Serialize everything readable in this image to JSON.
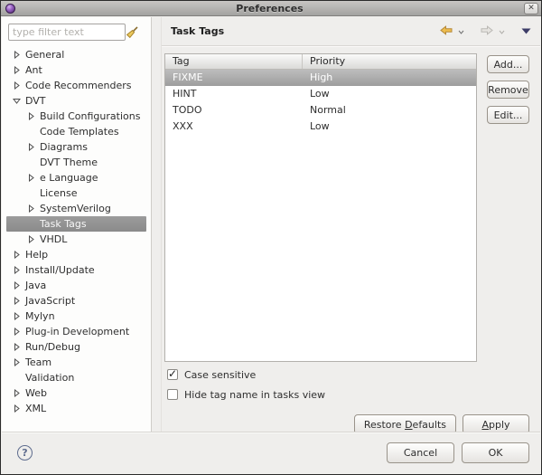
{
  "window": {
    "title": "Preferences",
    "close_glyph": "✕"
  },
  "sidebar": {
    "filter": {
      "placeholder": "type filter text",
      "clear_icon": "broom"
    },
    "items": [
      {
        "label": "General",
        "level": 0,
        "state": "collapsed",
        "selected": false
      },
      {
        "label": "Ant",
        "level": 0,
        "state": "collapsed",
        "selected": false
      },
      {
        "label": "Code Recommenders",
        "level": 0,
        "state": "collapsed",
        "selected": false
      },
      {
        "label": "DVT",
        "level": 0,
        "state": "expanded",
        "selected": false
      },
      {
        "label": "Build Configurations",
        "level": 1,
        "state": "collapsed",
        "selected": false
      },
      {
        "label": "Code Templates",
        "level": 1,
        "state": "leaf",
        "selected": false
      },
      {
        "label": "Diagrams",
        "level": 1,
        "state": "collapsed",
        "selected": false
      },
      {
        "label": "DVT Theme",
        "level": 1,
        "state": "leaf",
        "selected": false
      },
      {
        "label": "e Language",
        "level": 1,
        "state": "collapsed",
        "selected": false
      },
      {
        "label": "License",
        "level": 1,
        "state": "leaf",
        "selected": false
      },
      {
        "label": "SystemVerilog",
        "level": 1,
        "state": "collapsed",
        "selected": false
      },
      {
        "label": "Task Tags",
        "level": 1,
        "state": "leaf",
        "selected": true
      },
      {
        "label": "VHDL",
        "level": 1,
        "state": "collapsed",
        "selected": false
      },
      {
        "label": "Help",
        "level": 0,
        "state": "collapsed",
        "selected": false
      },
      {
        "label": "Install/Update",
        "level": 0,
        "state": "collapsed",
        "selected": false
      },
      {
        "label": "Java",
        "level": 0,
        "state": "collapsed",
        "selected": false
      },
      {
        "label": "JavaScript",
        "level": 0,
        "state": "collapsed",
        "selected": false
      },
      {
        "label": "Mylyn",
        "level": 0,
        "state": "collapsed",
        "selected": false
      },
      {
        "label": "Plug-in Development",
        "level": 0,
        "state": "collapsed",
        "selected": false
      },
      {
        "label": "Run/Debug",
        "level": 0,
        "state": "collapsed",
        "selected": false
      },
      {
        "label": "Team",
        "level": 0,
        "state": "collapsed",
        "selected": false
      },
      {
        "label": "Validation",
        "level": 0,
        "state": "leaf",
        "selected": false
      },
      {
        "label": "Web",
        "level": 0,
        "state": "collapsed",
        "selected": false
      },
      {
        "label": "XML",
        "level": 0,
        "state": "collapsed",
        "selected": false
      }
    ]
  },
  "content": {
    "title": "Task Tags",
    "nav_icons": [
      "back-arrow",
      "back-dropdown",
      "forward-arrow",
      "forward-dropdown",
      "view-menu"
    ],
    "table": {
      "columns": [
        "Tag",
        "Priority"
      ],
      "rows": [
        {
          "tag": "FIXME",
          "priority": "High",
          "selected": true
        },
        {
          "tag": "HINT",
          "priority": "Low",
          "selected": false
        },
        {
          "tag": "TODO",
          "priority": "Normal",
          "selected": false
        },
        {
          "tag": "XXX",
          "priority": "Low",
          "selected": false
        }
      ]
    },
    "side_buttons": [
      "Add...",
      "Remove",
      "Edit..."
    ],
    "checkboxes": [
      {
        "label": "Case sensitive",
        "checked": true
      },
      {
        "label": "Hide tag name in tasks view",
        "checked": false
      }
    ],
    "restore_defaults": {
      "label": "Restore Defaults",
      "mnemonic_index": 8
    },
    "apply": {
      "label": "Apply",
      "mnemonic_index": 0
    }
  },
  "footer": {
    "help": "?",
    "cancel": "Cancel",
    "ok": "OK"
  },
  "colors": {
    "titlebar_top": "#c7c6c4",
    "titlebar_bottom": "#a3a2a0",
    "dialog_bg": "#efeeec",
    "tree_bg": "#fdfdfc",
    "selection_gray": "#8b8b8b",
    "selected_text": "#ffffff",
    "back_arrow_gold": "#eebd4e",
    "view_menu_navy": "#3d3d68",
    "help_blue": "#5e6c8e",
    "logo_purple": "#9a63c4"
  }
}
